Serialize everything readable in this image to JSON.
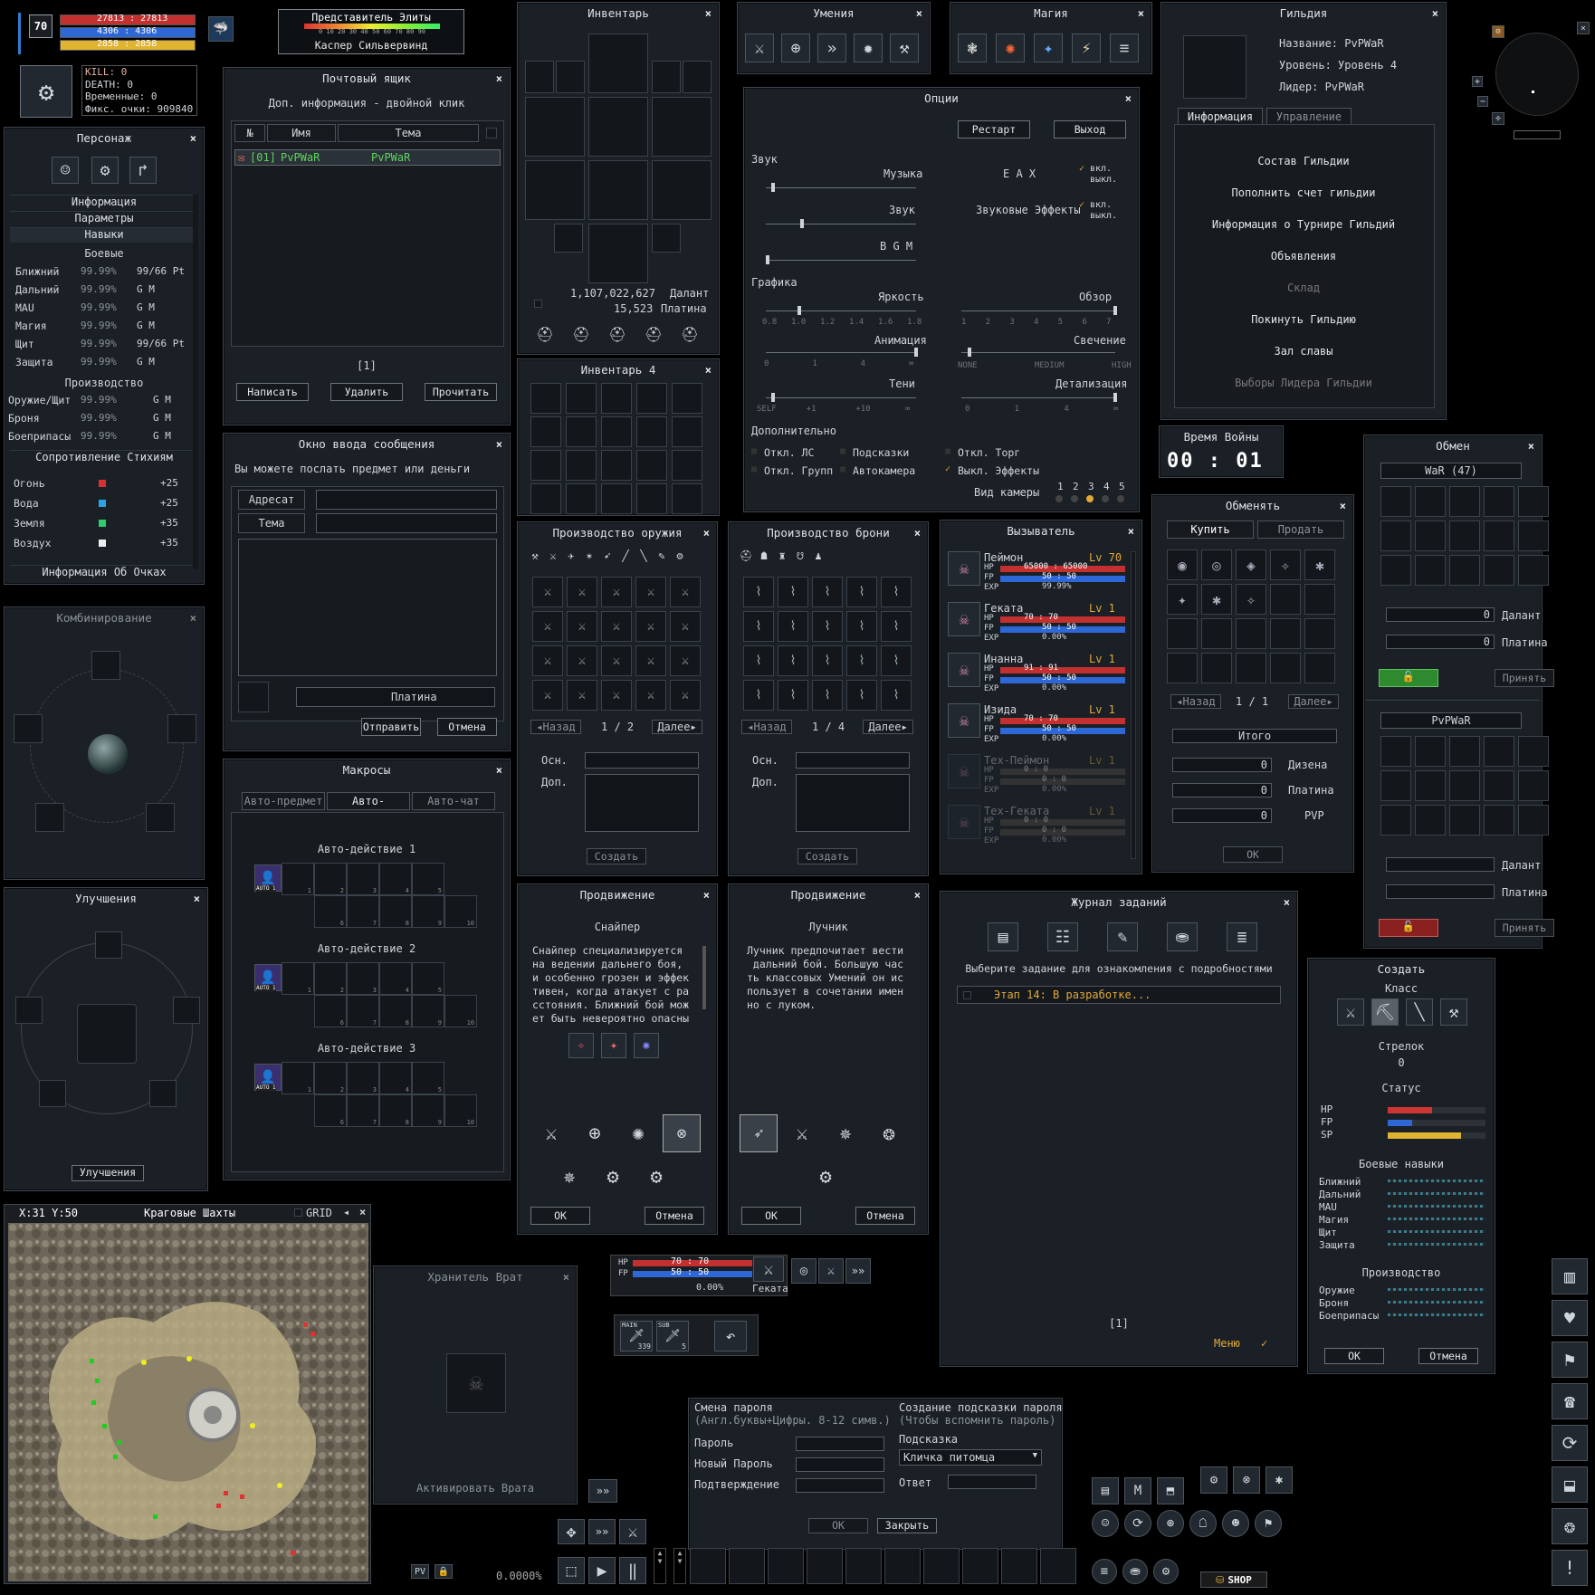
{
  "player": {
    "level": "70",
    "hp": "27813 : 27813",
    "fp": "4306 : 4306",
    "sp": "2858 : 2858"
  },
  "elite": {
    "title": "Представитель Элиты",
    "name": "Каспер Сильвервинд",
    "scale": "0 10 20 30 40 50 60 70 80 90"
  },
  "stats": {
    "kill": "KILL: 0",
    "death": "DEATH: 0",
    "temp": "Временные: 0",
    "fix": "Фикс. очки: 909840"
  },
  "character": {
    "title": "Персонаж",
    "rows": [
      "Информация",
      "Параметры",
      "Навыки"
    ],
    "combat_title": "Боевые",
    "combat": [
      [
        "Ближний",
        "99.99%",
        "99/66 Pt"
      ],
      [
        "Дальний",
        "99.99%",
        "G M"
      ],
      [
        "MAU",
        "99.99%",
        "G M"
      ],
      [
        "Магия",
        "99.99%",
        "G M"
      ],
      [
        "Щит",
        "99.99%",
        "99/66 Pt"
      ],
      [
        "Защита",
        "99.99%",
        "G M"
      ]
    ],
    "prod_title": "Производство",
    "prod": [
      [
        "Оружие/Щит",
        "99.99%",
        "G M"
      ],
      [
        "Броня",
        "99.99%",
        "G M"
      ],
      [
        "Боеприпасы",
        "99.99%",
        "G M"
      ]
    ],
    "elem_title": "Сопротивление Стихиям",
    "elem": [
      [
        "Огонь",
        "+25",
        "#d93131"
      ],
      [
        "Вода",
        "+25",
        "#2aa2e6"
      ],
      [
        "Земля",
        "+35",
        "#2ecc6a"
      ],
      [
        "Воздух",
        "+35",
        "#eeeeee"
      ]
    ],
    "points": "Информация Об Очках"
  },
  "mail": {
    "title": "Почтовый ящик",
    "hint": "Доп. информация - двойной клик",
    "cols": [
      "№",
      "Имя",
      "Тема"
    ],
    "row": {
      "num": "[01]",
      "name": "PvPWaR",
      "subject": "PvPWaR"
    },
    "page": "[1]",
    "buttons": [
      "Написать",
      "Удалить",
      "Прочитать"
    ]
  },
  "message": {
    "title": "Окно ввода сообщения",
    "hint": "Вы можете послать предмет или деньги",
    "to": "Адресат",
    "subject": "Тема",
    "currency": "Платина",
    "send": "Отправить",
    "cancel": "Отмена"
  },
  "combine": {
    "title": "Комбинирование"
  },
  "upgrade": {
    "title": "Улучшения",
    "button": "Улучшения"
  },
  "macros": {
    "title": "Макросы",
    "tabs": [
      "Авто-предмет",
      "Авто-действие",
      "Авто-чат"
    ],
    "groups": [
      "Авто-действие 1",
      "Авто-действие 2",
      "Авто-действие 3"
    ],
    "auto": "AUTO 1",
    "slots": [
      "1",
      "2",
      "3",
      "4",
      "5",
      "6",
      "7",
      "8",
      "9",
      "10"
    ]
  },
  "inventory": {
    "title": "Инвентарь",
    "money": "1,107,022,627",
    "money_unit": "Далант",
    "plat": "15,523",
    "plat_unit": "Платина"
  },
  "inventory4": {
    "title": "Инвентарь 4"
  },
  "skills": {
    "title": "Умения"
  },
  "magic": {
    "title": "Магия"
  },
  "options": {
    "title": "Опции",
    "restart": "Рестарт",
    "exit": "Выход",
    "sound": "Звук",
    "music": "Музыка",
    "sfx": "Звук",
    "bgm": "B G M",
    "eax": "E A X",
    "effects": "Звуковые Эффекты",
    "on": "вкл.",
    "off": "выкл.",
    "graphics": "Графика",
    "brightness": "Яркость",
    "view": "Обзор",
    "animation": "Анимация",
    "glow": "Свечение",
    "shadows": "Тени",
    "detail": "Детализация",
    "bright_ticks": [
      "0.8",
      "1.0",
      "1.2",
      "1.4",
      "1.6",
      "1.8"
    ],
    "view_ticks": [
      "1",
      "2",
      "3",
      "4",
      "5",
      "6",
      "7"
    ],
    "anim_ticks": [
      "0",
      "1",
      "4",
      "∞"
    ],
    "glow_ticks": [
      "NONE",
      "MEDIUM",
      "HIGH"
    ],
    "shadow_ticks": [
      "SELF",
      "+1",
      "+10",
      "∞"
    ],
    "detail_ticks": [
      "0",
      "1",
      "4",
      "∞"
    ],
    "extra": "Дополнительно",
    "checks": [
      "Откл. ЛС",
      "Подсказки",
      "Откл. Торг",
      "Откл. Групп",
      "Автокамера",
      "Выкл. Эффекты"
    ],
    "camera": "Вид камеры",
    "cam_nums": [
      "1",
      "2",
      "3",
      "4",
      "5"
    ]
  },
  "guild": {
    "title": "Гильдия",
    "name": "Название: PvPWaR",
    "level": "Уровень: Уровень 4",
    "leader": "Лидер: PvPWaR",
    "tabs": [
      "Информация",
      "Управление"
    ],
    "items": [
      "Состав Гильдии",
      "Пополнить счет гильдии",
      "Информация о Турнире Гильдий",
      "Объявления",
      "Склад",
      "Покинуть Гильдию",
      "Зал славы",
      "Выборы Лидера Гильдии"
    ]
  },
  "war": {
    "title": "Время Войны",
    "time": "00 : 01"
  },
  "trade": {
    "title": "Обмен",
    "partner": "WaR (47)",
    "zero": "0",
    "dalant": "Далант",
    "platina": "Платина",
    "accept": "Принять",
    "me": "PvPWaR"
  },
  "exchange": {
    "title": "Обменять",
    "buy": "Купить",
    "sell": "Продать",
    "prev": "Назад",
    "page": "1 / 1",
    "next": "Далее",
    "total": "Итого",
    "rows": [
      [
        "0",
        "Дизена"
      ],
      [
        "0",
        "Платина"
      ],
      [
        "0",
        "PVP"
      ]
    ],
    "ok": "OK"
  },
  "weapon_prod": {
    "title": "Производство оружия",
    "prev": "Назад",
    "page": "1 / 2",
    "next": "Далее",
    "main": "Осн.",
    "extra": "Доп.",
    "create": "Создать"
  },
  "armor_prod": {
    "title": "Производство брони",
    "prev": "Назад",
    "page": "1 / 4",
    "next": "Далее",
    "main": "Осн.",
    "extra": "Доп.",
    "create": "Создать"
  },
  "summoner": {
    "title": "Вызыватель",
    "pets": [
      {
        "name": "Пеймон",
        "lv": "Lv 70",
        "hp": "65000 : 65000",
        "fp": "50 : 50",
        "exp": "99.99%",
        "hpf": 1,
        "active": true
      },
      {
        "name": "Геката",
        "lv": "Lv 1",
        "hp": "70 : 70",
        "fp": "50 : 50",
        "exp": "0.00%",
        "hpf": 1,
        "active": true
      },
      {
        "name": "Инанна",
        "lv": "Lv 1",
        "hp": "91 : 91",
        "fp": "50 : 50",
        "exp": "0.00%",
        "hpf": 1,
        "active": true
      },
      {
        "name": "Изида",
        "lv": "Lv 1",
        "hp": "70 : 70",
        "fp": "50 : 50",
        "exp": "0.00%",
        "hpf": 1,
        "active": true
      },
      {
        "name": "Тех-Пеймон",
        "lv": "Lv 1",
        "hp": "0 : 0",
        "fp": "0 : 0",
        "exp": "0.00%",
        "hpf": 0,
        "active": false
      },
      {
        "name": "Тех-Геката",
        "lv": "Lv 1",
        "hp": "0 : 0",
        "fp": "0 : 0",
        "exp": "0.00%",
        "hpf": 0,
        "active": false
      }
    ]
  },
  "promo_sniper": {
    "title": "Продвижение",
    "cls": "Снайпер",
    "text": "Снайпер специализируется\nна ведении дальнего боя,\nи особенно грозен и эффек\nтивен, когда атакует с ра\nсстояния. Ближний бой мож\nет быть невероятно опасны",
    "ok": "OK",
    "cancel": "Отмена"
  },
  "promo_archer": {
    "title": "Продвижение",
    "cls": "Лучник",
    "text": "Лучник предпочитает вести\n дальний бой. Большую час\nть классовых Умений он ис\nпользует в сочетании имен\nно с луком.",
    "ok": "OK",
    "cancel": "Отмена"
  },
  "quests": {
    "title": "Журнал заданий",
    "hint": "Выберите задание для ознакомления с подробностями",
    "entry": "Этап 14:  В разработке...",
    "page": "[1]",
    "menu": "Меню"
  },
  "create": {
    "title": "Создать",
    "class_label": "Класс",
    "class_name": "Стрелок",
    "class_val": "0",
    "status": "Статус",
    "hp": "HP",
    "fp": "FP",
    "sp": "SP",
    "combat": "Боевые навыки",
    "combat_rows": [
      "Ближний",
      "Дальний",
      "MAU",
      "Магия",
      "Щит",
      "Защита"
    ],
    "prod": "Производство",
    "prod_rows": [
      "Оружие",
      "Броня",
      "Боеприпасы"
    ],
    "ok": "OK",
    "cancel": "Отмена"
  },
  "map": {
    "coords": "X:31 Y:50",
    "name": "Краговые Шахты",
    "grid": "GRID"
  },
  "gate": {
    "title": "Хранитель Врат",
    "activate": "Активировать Врата"
  },
  "target": {
    "hp": "70 : 70",
    "fp": "50 : 50",
    "exp": "0.00%",
    "name": "Геката"
  },
  "weapons": {
    "main": "MAIN",
    "main_count": "339",
    "sub": "SUB",
    "sub_count": "5"
  },
  "password": {
    "title": "Смена пароля",
    "hint": "(Англ.буквы+Цифры. 8-12 симв.)",
    "pwd": "Пароль",
    "newpwd": "Новый Пароль",
    "confirm": "Подтверждение",
    "hint_title": "Создание подсказки пароля",
    "hint_sub": "(Чтобы вспомнить пароль)",
    "prompt": "Подсказка",
    "prompt_val": "Кличка питомца",
    "answer": "Ответ",
    "ok": "OK",
    "close": "Закрыть"
  },
  "hud": {
    "exp": "0.0000%",
    "shop": "SHOP"
  }
}
